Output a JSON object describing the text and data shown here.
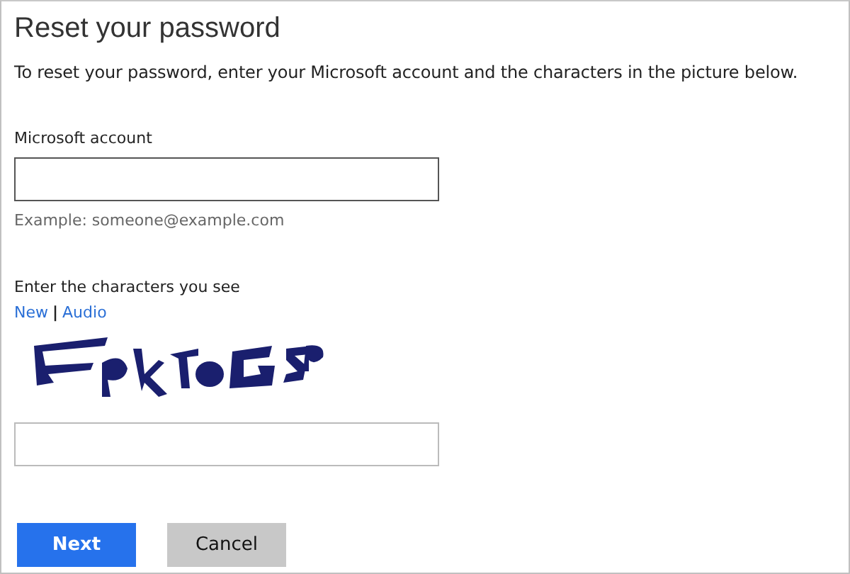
{
  "title": "Reset your password",
  "intro": "To reset your password, enter your Microsoft account and the characters in the picture below.",
  "account_field": {
    "label": "Microsoft account",
    "focused": true,
    "hint": "Example: someone@example.com"
  },
  "captcha": {
    "label": "Enter the characters you see",
    "links": [
      "New",
      "Audio"
    ],
    "separator": "|",
    "kind": "picture",
    "answer_field": {
      "focused": false
    }
  },
  "buttons": [
    {
      "label": "Next",
      "kind": "primary"
    },
    {
      "label": "Cancel",
      "kind": "secondary"
    }
  ]
}
